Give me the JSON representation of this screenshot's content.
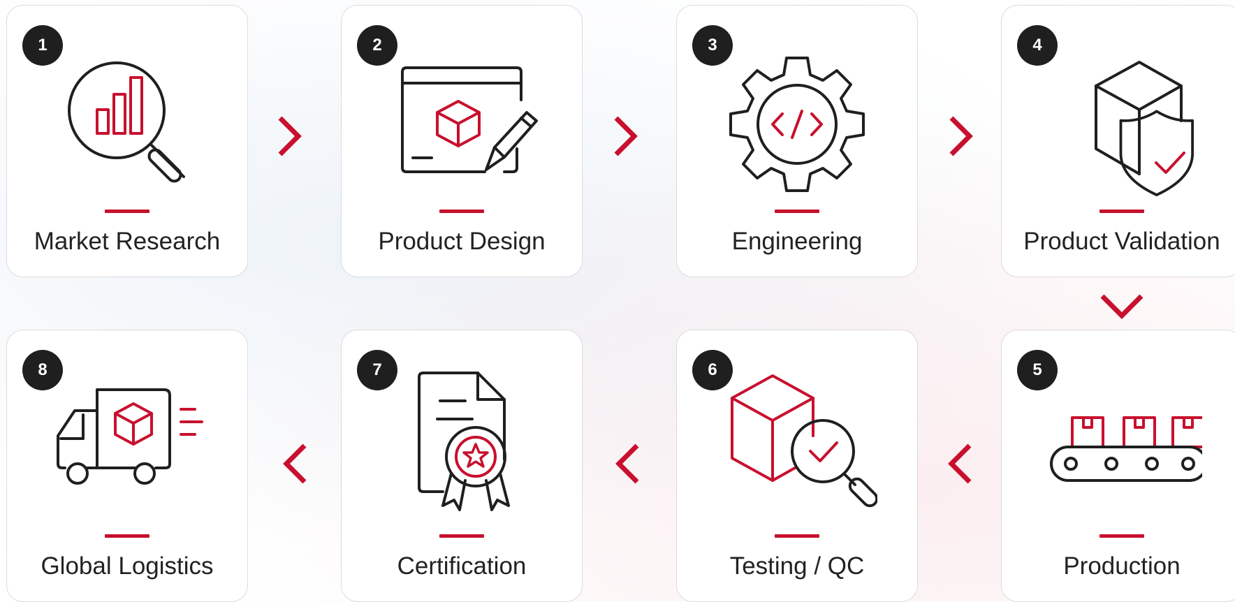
{
  "accent_color": "#c8102e",
  "steps": [
    {
      "number": "1",
      "label": "Market Research",
      "icon": "magnifier-chart-icon"
    },
    {
      "number": "2",
      "label": "Product Design",
      "icon": "design-window-pencil-icon"
    },
    {
      "number": "3",
      "label": "Engineering",
      "icon": "gear-code-icon"
    },
    {
      "number": "4",
      "label": "Product Validation",
      "icon": "box-shield-check-icon"
    },
    {
      "number": "5",
      "label": "Production",
      "icon": "conveyor-belt-icon"
    },
    {
      "number": "6",
      "label": "Testing / QC",
      "icon": "box-magnifier-check-icon"
    },
    {
      "number": "7",
      "label": "Certification",
      "icon": "document-award-icon"
    },
    {
      "number": "8",
      "label": "Global Logistics",
      "icon": "delivery-truck-icon"
    }
  ],
  "arrows": [
    {
      "from": "1",
      "to": "2",
      "direction": "right"
    },
    {
      "from": "2",
      "to": "3",
      "direction": "right"
    },
    {
      "from": "3",
      "to": "4",
      "direction": "right"
    },
    {
      "from": "4",
      "to": "5",
      "direction": "down"
    },
    {
      "from": "5",
      "to": "6",
      "direction": "left"
    },
    {
      "from": "6",
      "to": "7",
      "direction": "left"
    },
    {
      "from": "7",
      "to": "8",
      "direction": "left"
    }
  ]
}
